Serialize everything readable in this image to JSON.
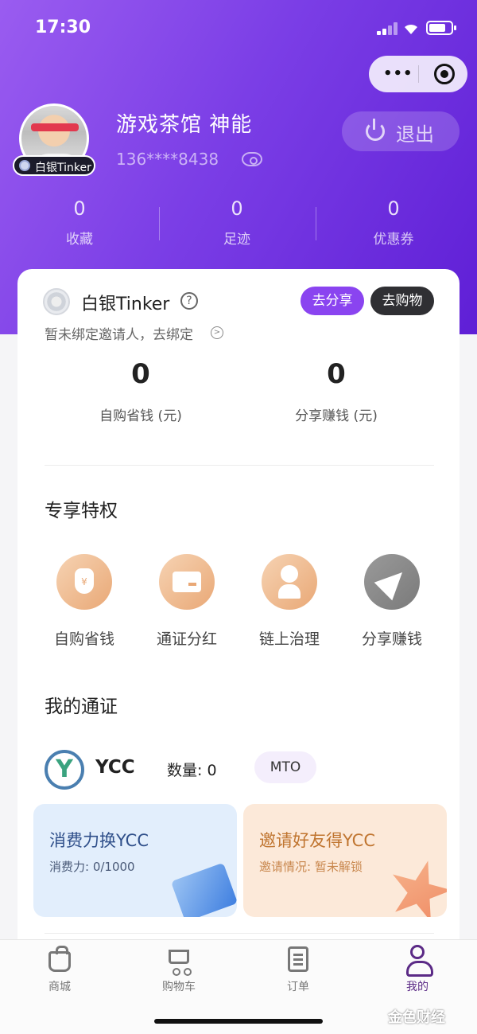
{
  "status_bar": {
    "time": "17:30"
  },
  "capsule": {
    "more": "•••"
  },
  "profile": {
    "level_tag": "白银Tinker",
    "username": "游戏茶馆 神能",
    "phone": "136****8438",
    "logout_label": "退出"
  },
  "stats": [
    {
      "value": "0",
      "label": "收藏"
    },
    {
      "value": "0",
      "label": "足迹"
    },
    {
      "value": "0",
      "label": "优惠券"
    }
  ],
  "member": {
    "level_name": "白银Tinker",
    "help": "?",
    "share_button": "去分享",
    "shop_button": "去购物",
    "invite_tip": "暂未绑定邀请人，去绑定",
    "chev": ">",
    "savings": {
      "value": "0",
      "label": "自购省钱 (元)"
    },
    "earnings": {
      "value": "0",
      "label": "分享赚钱 (元)"
    }
  },
  "privileges": {
    "title": "专享特权",
    "items": [
      {
        "label": "自购省钱",
        "icon": "money-bag-icon",
        "bag_text": "¥"
      },
      {
        "label": "通证分红",
        "icon": "card-icon"
      },
      {
        "label": "链上治理",
        "icon": "person-icon"
      },
      {
        "label": "分享赚钱",
        "icon": "send-icon"
      }
    ]
  },
  "tokens": {
    "title": "我的通证",
    "logo_text": "Y",
    "name": "YCC",
    "quantity": "数量: 0",
    "tag": "MTO"
  },
  "promos": [
    {
      "title": "消费力换YCC",
      "subtitle": "消费力: 0/1000",
      "color": "#e2eefc"
    },
    {
      "title": "邀请好友得YCC",
      "subtitle": "邀请情况: 暂未解锁",
      "color": "#fce9d9"
    }
  ],
  "tabs": [
    {
      "label": "商城",
      "icon": "bag-icon"
    },
    {
      "label": "购物车",
      "icon": "cart-icon"
    },
    {
      "label": "订单",
      "icon": "order-doc-icon"
    },
    {
      "label": "我的",
      "icon": "user-icon",
      "active": true
    }
  ],
  "watermark": "金色财经",
  "colors": {
    "hero_start": "#9a5cf0",
    "hero_end": "#5f1fd6",
    "accent_purple": "#8a44f0",
    "active_tab": "#5b2a86"
  }
}
